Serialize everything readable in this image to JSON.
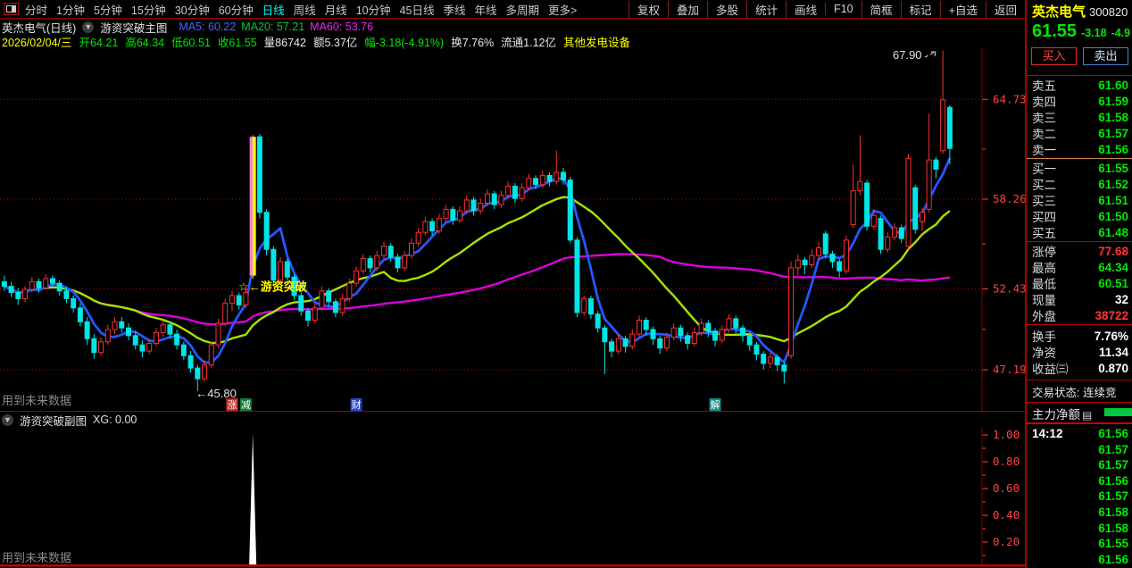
{
  "colors": {
    "up": "#ff2f2f",
    "down": "#00e5e5",
    "ma5_line": "#2457ff",
    "ma20_line": "#a4e400",
    "ma60_line": "#dd00dd",
    "grid": "#b00000",
    "axis_text": "#ff4242",
    "highlight_body": "#ffff00",
    "highlight_edge": "#ff82c8",
    "signal_text": "#ffff00",
    "annotation": "#e2e2e2",
    "warning": "#8a8a8a",
    "spike": "#ffffff"
  },
  "toolbar": {
    "periods": [
      {
        "label": "分时"
      },
      {
        "label": "1分钟"
      },
      {
        "label": "5分钟"
      },
      {
        "label": "15分钟"
      },
      {
        "label": "30分钟"
      },
      {
        "label": "60分钟"
      },
      {
        "label": "日线",
        "active": true
      },
      {
        "label": "周线"
      },
      {
        "label": "月线"
      },
      {
        "label": "10分钟"
      },
      {
        "label": "45日线"
      },
      {
        "label": "季线"
      },
      {
        "label": "年线"
      },
      {
        "label": "多周期"
      },
      {
        "label": "更多>"
      }
    ],
    "actions": [
      "复权",
      "叠加",
      "多股",
      "统计",
      "画线",
      "F10",
      "简框",
      "标记",
      "+自选",
      "返回"
    ]
  },
  "chart_header": {
    "title": "英杰电气(日线)",
    "indicator": "游资突破主图",
    "ma_labels": [
      {
        "text": "MA5: 60.22",
        "color": "#4466ff"
      },
      {
        "text": "MA20: 57.21",
        "color": "#00cc33"
      },
      {
        "text": "MA60: 53.76",
        "color": "#ee22ee"
      }
    ]
  },
  "info_bar": [
    {
      "text": "2026/02/04/三",
      "color": "#ffff00"
    },
    {
      "text": "开64.21",
      "color": "#00e800"
    },
    {
      "text": "高64.34",
      "color": "#00e800"
    },
    {
      "text": "低60.51",
      "color": "#00e800"
    },
    {
      "text": "收61.55",
      "color": "#00e800"
    },
    {
      "text": "量86742",
      "color": "#e8e8e8"
    },
    {
      "text": "额5.37亿",
      "color": "#e8e8e8"
    },
    {
      "text": "幅-3.18(-4.91%)",
      "color": "#00e800"
    },
    {
      "text": "换7.76%",
      "color": "#e8e8e8"
    },
    {
      "text": "流通1.12亿",
      "color": "#e8e8e8"
    },
    {
      "text": "其他发电设备",
      "color": "#ffff00"
    }
  ],
  "chart_data": {
    "type": "candlestick",
    "price_axis": {
      "labels": [
        "64.73",
        "58.26",
        "52.43",
        "47.19"
      ],
      "values": [
        64.73,
        58.26,
        52.43,
        47.19
      ],
      "max": 68.05,
      "min": 45.45
    },
    "ma": [
      {
        "name": "MA5",
        "period": 5
      },
      {
        "name": "MA20",
        "period": 20
      },
      {
        "name": "MA60",
        "period": 60
      }
    ],
    "candles": [
      [
        52.9,
        53.3,
        52.3,
        52.6
      ],
      [
        52.6,
        52.9,
        51.9,
        52.2
      ],
      [
        52.2,
        52.5,
        51.4,
        51.8
      ],
      [
        51.8,
        52.6,
        51.6,
        52.4
      ],
      [
        52.4,
        53.2,
        52.2,
        52.9
      ],
      [
        52.9,
        53.1,
        52.2,
        52.5
      ],
      [
        52.5,
        53.4,
        52.4,
        53.1
      ],
      [
        53.1,
        53.3,
        52.5,
        52.8
      ],
      [
        52.8,
        53.0,
        52.0,
        52.3
      ],
      [
        52.3,
        52.6,
        51.5,
        51.8
      ],
      [
        51.8,
        52.0,
        50.9,
        51.2
      ],
      [
        51.2,
        51.5,
        50.0,
        50.3
      ],
      [
        50.3,
        50.6,
        48.8,
        49.2
      ],
      [
        49.2,
        49.5,
        47.9,
        48.3
      ],
      [
        48.3,
        49.3,
        48.1,
        49.0
      ],
      [
        49.0,
        50.1,
        48.8,
        49.8
      ],
      [
        49.8,
        50.6,
        49.5,
        50.3
      ],
      [
        50.3,
        50.6,
        49.6,
        49.9
      ],
      [
        49.9,
        50.2,
        49.1,
        49.4
      ],
      [
        49.4,
        49.7,
        48.5,
        48.8
      ],
      [
        48.8,
        49.1,
        48.0,
        48.4
      ],
      [
        48.4,
        49.2,
        48.2,
        48.9
      ],
      [
        48.9,
        49.9,
        48.7,
        49.6
      ],
      [
        49.6,
        50.4,
        49.3,
        50.1
      ],
      [
        50.1,
        50.3,
        49.2,
        49.5
      ],
      [
        49.5,
        49.8,
        48.5,
        48.8
      ],
      [
        48.8,
        49.0,
        47.8,
        48.1
      ],
      [
        48.1,
        48.4,
        47.0,
        47.3
      ],
      [
        47.3,
        47.5,
        45.8,
        46.6
      ],
      [
        46.6,
        47.8,
        46.4,
        47.5
      ],
      [
        47.5,
        49.0,
        47.3,
        48.8
      ],
      [
        48.8,
        50.5,
        48.6,
        50.2
      ],
      [
        50.2,
        51.8,
        50.0,
        51.5
      ],
      [
        51.5,
        52.3,
        51.0,
        52.0
      ],
      [
        52.0,
        52.2,
        51.1,
        51.4
      ],
      [
        51.4,
        52.5,
        51.2,
        52.2
      ],
      [
        53.3,
        62.4,
        53.1,
        62.3
      ],
      [
        62.3,
        62.5,
        57.0,
        57.4
      ],
      [
        57.4,
        57.6,
        54.6,
        55.0
      ],
      [
        55.0,
        55.2,
        52.6,
        53.0
      ],
      [
        53.0,
        54.5,
        52.8,
        54.2
      ],
      [
        54.2,
        54.4,
        52.9,
        53.2
      ],
      [
        53.2,
        53.4,
        51.7,
        52.0
      ],
      [
        52.0,
        52.2,
        50.7,
        51.0
      ],
      [
        51.0,
        51.2,
        50.0,
        50.4
      ],
      [
        50.4,
        51.5,
        50.2,
        51.2
      ],
      [
        51.2,
        52.6,
        51.0,
        52.3
      ],
      [
        52.3,
        52.5,
        51.3,
        51.6
      ],
      [
        51.6,
        51.8,
        50.6,
        50.9
      ],
      [
        50.9,
        52.1,
        50.7,
        51.8
      ],
      [
        51.8,
        53.1,
        51.6,
        52.8
      ],
      [
        52.8,
        53.9,
        52.6,
        53.6
      ],
      [
        53.6,
        54.7,
        53.4,
        54.4
      ],
      [
        54.4,
        54.6,
        53.5,
        53.8
      ],
      [
        53.8,
        54.9,
        53.6,
        54.6
      ],
      [
        54.6,
        55.5,
        54.4,
        55.2
      ],
      [
        55.2,
        55.4,
        54.2,
        54.5
      ],
      [
        54.5,
        54.7,
        53.5,
        53.8
      ],
      [
        53.8,
        54.9,
        53.6,
        54.6
      ],
      [
        54.6,
        55.7,
        54.4,
        55.4
      ],
      [
        55.4,
        56.4,
        55.2,
        56.1
      ],
      [
        56.1,
        57.1,
        55.9,
        56.8
      ],
      [
        56.8,
        57.0,
        55.9,
        56.2
      ],
      [
        56.2,
        57.3,
        56.0,
        57.0
      ],
      [
        57.0,
        57.9,
        56.8,
        57.6
      ],
      [
        57.6,
        57.8,
        56.6,
        56.9
      ],
      [
        56.9,
        57.8,
        56.7,
        57.5
      ],
      [
        57.5,
        58.5,
        57.3,
        58.2
      ],
      [
        58.2,
        58.4,
        57.2,
        57.5
      ],
      [
        57.5,
        58.3,
        57.3,
        58.0
      ],
      [
        58.0,
        58.9,
        57.8,
        58.6
      ],
      [
        58.6,
        58.8,
        57.6,
        57.9
      ],
      [
        57.9,
        58.8,
        57.7,
        58.5
      ],
      [
        58.5,
        59.4,
        58.3,
        59.1
      ],
      [
        59.1,
        59.3,
        58.0,
        58.3
      ],
      [
        58.3,
        59.3,
        58.1,
        59.0
      ],
      [
        59.0,
        59.9,
        58.8,
        59.6
      ],
      [
        59.6,
        59.8,
        58.9,
        59.2
      ],
      [
        59.2,
        60.1,
        59.0,
        59.8
      ],
      [
        59.8,
        60.0,
        59.1,
        59.4
      ],
      [
        59.4,
        61.4,
        59.2,
        60.0
      ],
      [
        60.0,
        60.3,
        59.2,
        59.5
      ],
      [
        59.5,
        59.7,
        55.4,
        55.6
      ],
      [
        55.6,
        55.8,
        50.6,
        50.9
      ],
      [
        50.9,
        52.0,
        50.7,
        51.8
      ],
      [
        51.8,
        52.0,
        50.5,
        50.8
      ],
      [
        50.8,
        51.0,
        49.6,
        49.9
      ],
      [
        49.9,
        50.1,
        46.9,
        49.0
      ],
      [
        49.0,
        49.2,
        48.0,
        48.4
      ],
      [
        48.4,
        49.5,
        48.2,
        49.2
      ],
      [
        49.2,
        49.4,
        48.3,
        48.7
      ],
      [
        48.7,
        49.8,
        48.5,
        49.5
      ],
      [
        49.5,
        50.7,
        49.3,
        50.4
      ],
      [
        50.4,
        50.6,
        49.4,
        49.8
      ],
      [
        49.8,
        50.0,
        48.8,
        49.2
      ],
      [
        49.2,
        49.4,
        48.2,
        48.6
      ],
      [
        48.6,
        49.6,
        48.4,
        49.3
      ],
      [
        49.3,
        50.2,
        49.1,
        49.9
      ],
      [
        49.9,
        50.1,
        49.0,
        49.4
      ],
      [
        49.4,
        49.6,
        48.5,
        48.9
      ],
      [
        48.9,
        49.9,
        48.7,
        49.6
      ],
      [
        49.6,
        50.5,
        49.4,
        50.2
      ],
      [
        50.2,
        50.4,
        49.3,
        49.7
      ],
      [
        49.7,
        49.9,
        48.7,
        49.1
      ],
      [
        49.1,
        50.1,
        48.9,
        49.8
      ],
      [
        49.8,
        50.8,
        49.6,
        50.5
      ],
      [
        50.5,
        50.7,
        49.5,
        49.9
      ],
      [
        49.9,
        50.1,
        49.0,
        49.4
      ],
      [
        49.4,
        49.6,
        48.4,
        48.8
      ],
      [
        48.8,
        49.0,
        47.8,
        48.2
      ],
      [
        48.2,
        48.4,
        47.2,
        47.6
      ],
      [
        47.6,
        48.3,
        47.3,
        48.0
      ],
      [
        48.0,
        48.2,
        47.1,
        47.5
      ],
      [
        47.5,
        47.7,
        46.3,
        47.1
      ],
      [
        48.1,
        54.2,
        47.9,
        53.8
      ],
      [
        53.8,
        54.7,
        53.3,
        54.3
      ],
      [
        54.3,
        54.5,
        53.4,
        54.0
      ],
      [
        54.0,
        55.0,
        53.8,
        54.6
      ],
      [
        54.6,
        55.5,
        54.4,
        55.1
      ],
      [
        56.0,
        56.2,
        54.4,
        54.7
      ],
      [
        54.7,
        54.9,
        53.8,
        54.2
      ],
      [
        54.2,
        54.4,
        53.2,
        53.6
      ],
      [
        53.6,
        55.9,
        53.4,
        55.6
      ],
      [
        56.6,
        60.5,
        56.4,
        58.8
      ],
      [
        58.8,
        62.4,
        58.5,
        59.4
      ],
      [
        59.3,
        59.5,
        56.2,
        56.5
      ],
      [
        56.5,
        57.6,
        56.3,
        57.2
      ],
      [
        57.0,
        57.2,
        54.7,
        55.0
      ],
      [
        55.0,
        56.1,
        54.8,
        55.8
      ],
      [
        55.8,
        56.7,
        55.6,
        56.4
      ],
      [
        56.4,
        56.6,
        55.4,
        55.7
      ],
      [
        55.2,
        61.2,
        55.0,
        60.9
      ],
      [
        59.0,
        59.2,
        56.0,
        56.3
      ],
      [
        56.8,
        57.7,
        56.2,
        57.4
      ],
      [
        57.6,
        63.8,
        57.4,
        60.8
      ],
      [
        60.8,
        61.0,
        59.6,
        60.2
      ],
      [
        61.4,
        67.9,
        61.2,
        64.7
      ],
      [
        64.21,
        64.34,
        60.51,
        61.55
      ]
    ],
    "highlight": {
      "index": 36,
      "label": "☆←游资突破"
    },
    "annotations": [
      {
        "text": "67.90",
        "type": "peak",
        "index": 136,
        "price": 67.9
      },
      {
        "text": "←45.80",
        "type": "low",
        "index": 28,
        "price": 45.8
      }
    ],
    "badges": [
      {
        "text": "涨",
        "bg": "#c03020",
        "fg": "#ffffff",
        "index": 33
      },
      {
        "text": "减",
        "bg": "#107a30",
        "fg": "#ffffff",
        "index": 35
      },
      {
        "text": "财",
        "bg": "#2244cc",
        "fg": "#ffffff",
        "index": 51
      },
      {
        "text": "解",
        "bg": "#0d8a8a",
        "fg": "#ffffff",
        "index": 103
      }
    ],
    "warning": "用到未来数据",
    "sub": {
      "title": "游资突破副图",
      "value_label": "XG: 0.00",
      "axis_labels": [
        "1.00",
        "0.80",
        "0.60",
        "0.40",
        "0.20"
      ],
      "axis_values": [
        1.0,
        0.8,
        0.6,
        0.4,
        0.2
      ],
      "signal_index": 36,
      "signal_value": 1.0,
      "warning": "用到未来数据"
    }
  },
  "quote": {
    "name": "英杰电气",
    "code": "300820",
    "price": "61.55",
    "change": "-3.18",
    "change_pct": "-4.9",
    "buy_label": "买入",
    "sell_label": "卖出",
    "asks": [
      {
        "label": "卖五",
        "price": "61.60"
      },
      {
        "label": "卖四",
        "price": "61.59"
      },
      {
        "label": "卖三",
        "price": "61.58"
      },
      {
        "label": "卖二",
        "price": "61.57"
      },
      {
        "label": "卖一",
        "price": "61.56"
      }
    ],
    "bids": [
      {
        "label": "买一",
        "price": "61.55"
      },
      {
        "label": "买二",
        "price": "61.52"
      },
      {
        "label": "买三",
        "price": "61.51"
      },
      {
        "label": "买四",
        "price": "61.50"
      },
      {
        "label": "买五",
        "price": "61.48"
      }
    ],
    "stats1": [
      {
        "label": "涨停",
        "value": "77.68",
        "color": "red"
      },
      {
        "label": "最高",
        "value": "64.34",
        "color": "green"
      },
      {
        "label": "最低",
        "value": "60.51",
        "color": "green"
      },
      {
        "label": "现量",
        "value": "32",
        "color": "white"
      },
      {
        "label": "外盘",
        "value": "38722",
        "color": "red"
      }
    ],
    "stats2": [
      {
        "label": "换手",
        "value": "7.76%",
        "color": "white"
      },
      {
        "label": "净资",
        "value": "11.34",
        "color": "white"
      },
      {
        "label": "收益㈢",
        "value": "0.870",
        "color": "white"
      }
    ],
    "trade_status": "交易状态: 连续竞",
    "main_flow_label": "主力净额",
    "ticks": [
      {
        "time": "14:12",
        "price": "61.56"
      },
      {
        "time": "",
        "price": "61.57"
      },
      {
        "time": "",
        "price": "61.57"
      },
      {
        "time": "",
        "price": "61.56"
      },
      {
        "time": "",
        "price": "61.57"
      },
      {
        "time": "",
        "price": "61.58"
      },
      {
        "time": "",
        "price": "61.58"
      },
      {
        "time": "",
        "price": "61.55"
      },
      {
        "time": "",
        "price": "61.56"
      }
    ]
  }
}
